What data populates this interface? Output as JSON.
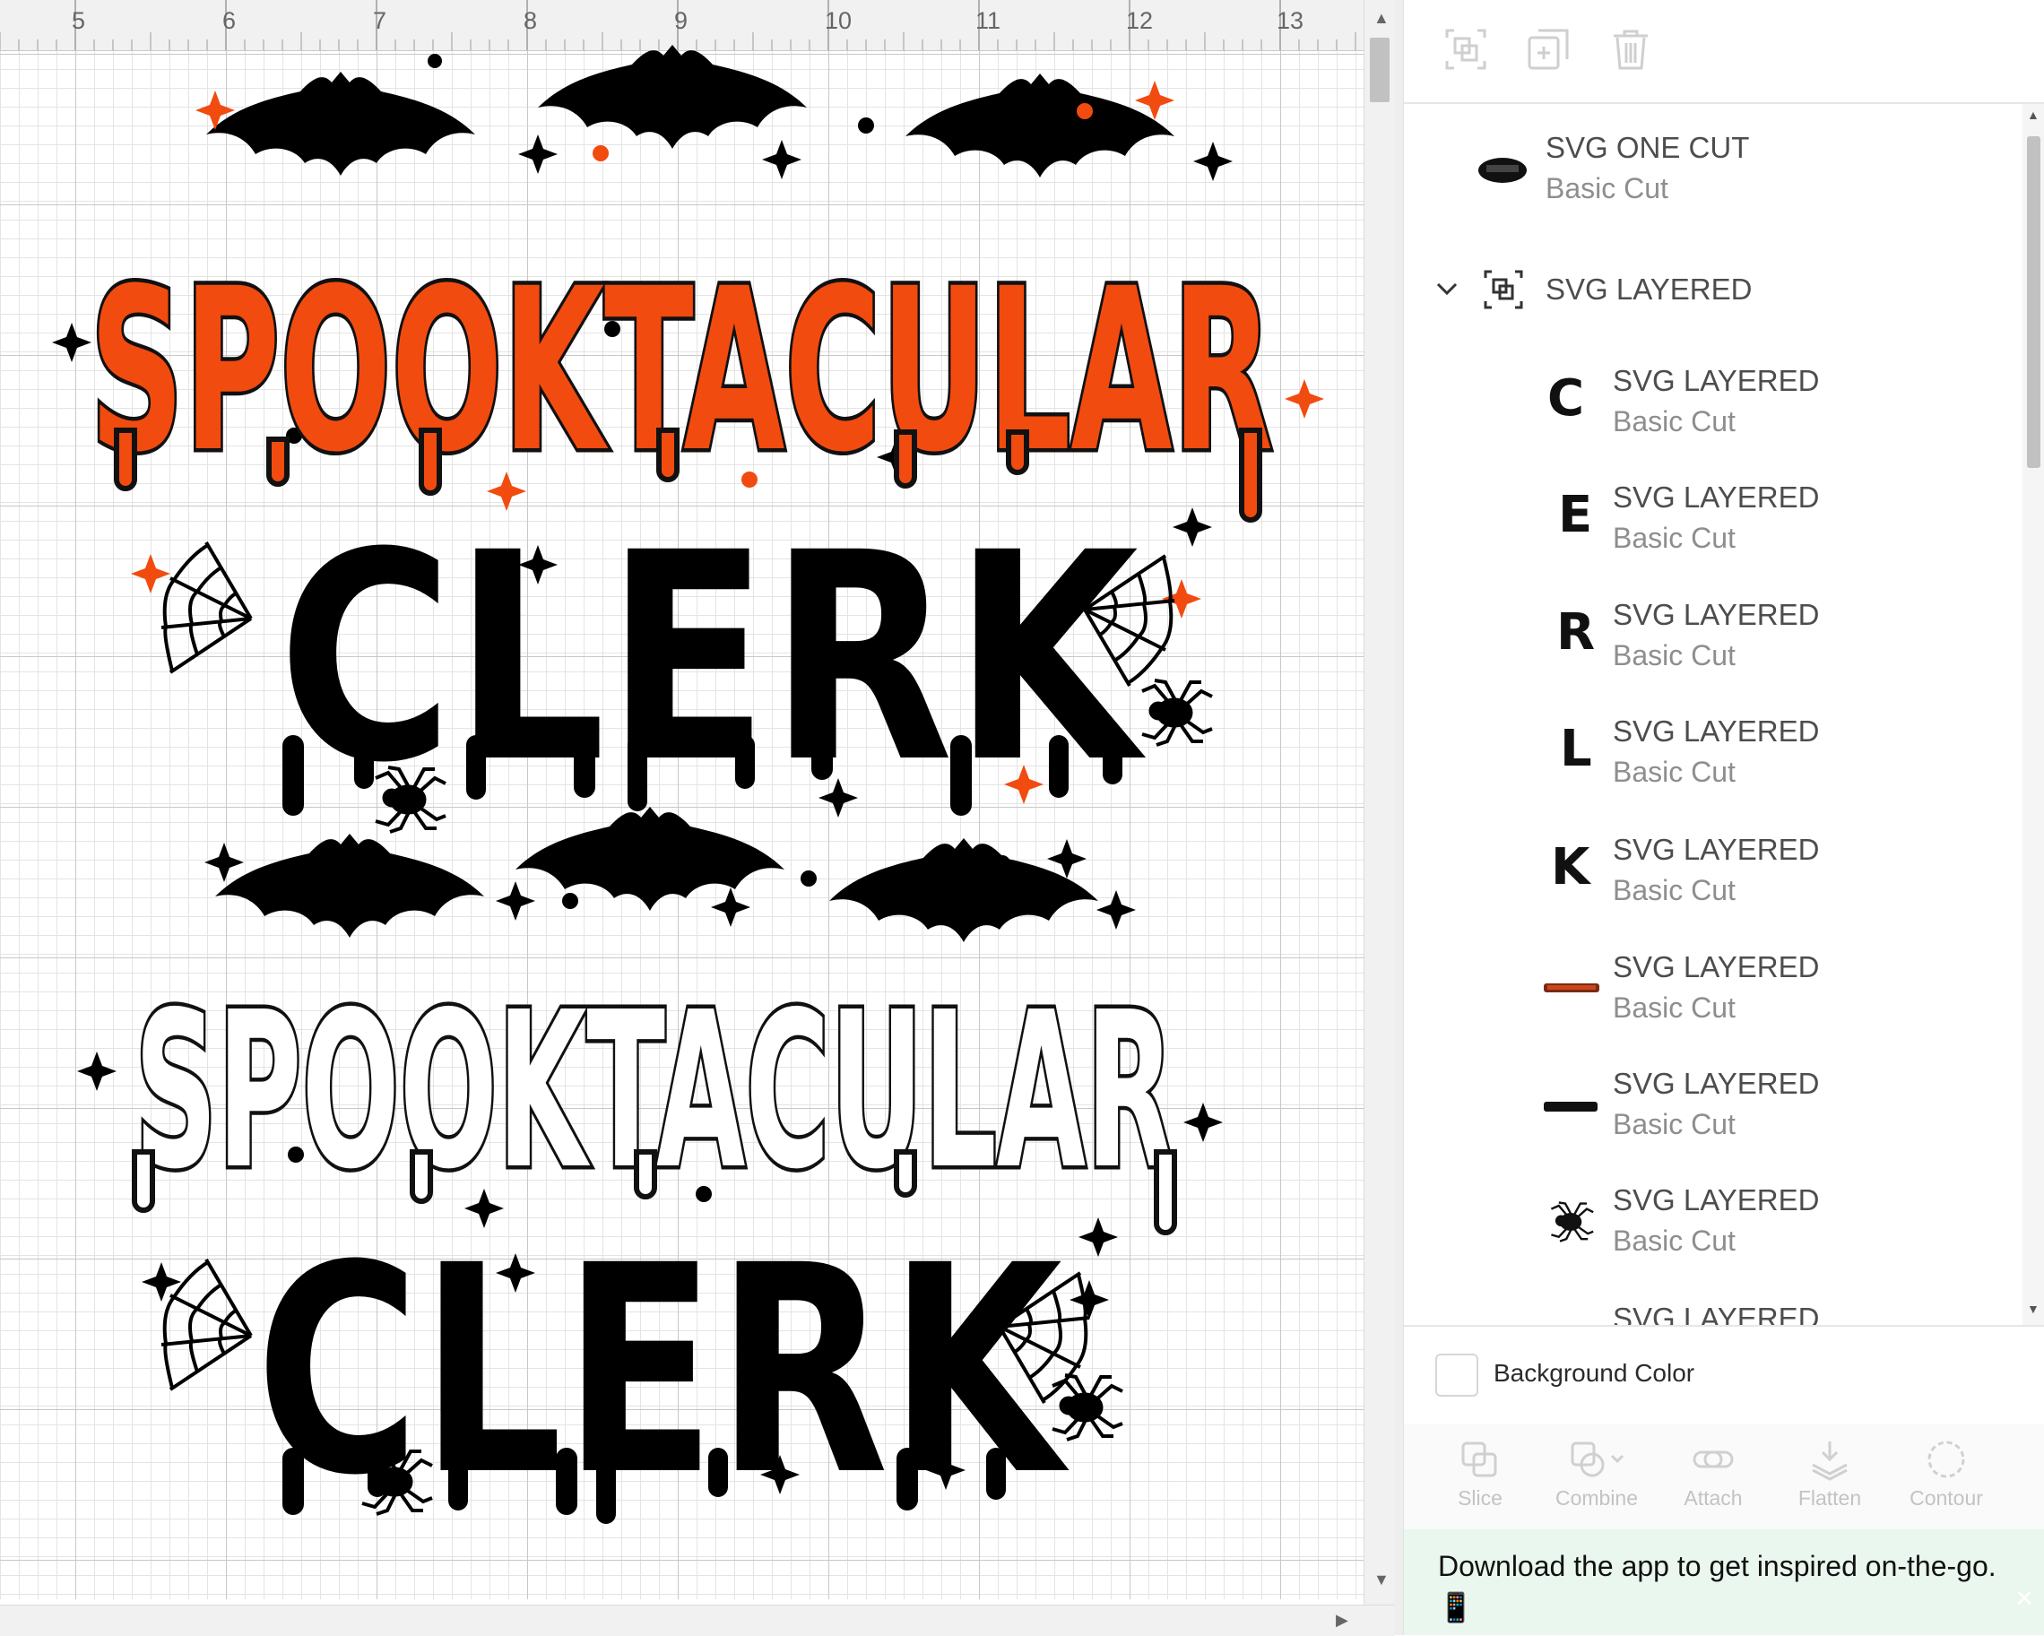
{
  "ruler": {
    "numbers": [
      "5",
      "6",
      "7",
      "8",
      "9",
      "10",
      "11",
      "12",
      "13"
    ]
  },
  "design": {
    "top": {
      "word1": "SPOOKTACULAR",
      "word2": "CLERK"
    },
    "bottom": {
      "word1": "SPOOKTACULAR",
      "word2": "CLERK"
    },
    "colors": {
      "orange": "#f24b0f",
      "black": "#000000",
      "outline": "#111111"
    }
  },
  "toolbar": {
    "icons": [
      "group-icon",
      "duplicate-icon",
      "delete-icon"
    ]
  },
  "layers": {
    "items": [
      {
        "name": "SVG ONE CUT",
        "sub": "Basic Cut",
        "thumb": "spooktacular-thumb"
      },
      {
        "name": "SVG LAYERED",
        "group": true
      },
      {
        "name": "SVG LAYERED",
        "sub": "Basic Cut",
        "thumb": "letter-c-thumb"
      },
      {
        "name": "SVG LAYERED",
        "sub": "Basic Cut",
        "thumb": "letter-e-thumb"
      },
      {
        "name": "SVG LAYERED",
        "sub": "Basic Cut",
        "thumb": "letter-r-thumb"
      },
      {
        "name": "SVG LAYERED",
        "sub": "Basic Cut",
        "thumb": "letter-l-thumb"
      },
      {
        "name": "SVG LAYERED",
        "sub": "Basic Cut",
        "thumb": "letter-k-thumb"
      },
      {
        "name": "SVG LAYERED",
        "sub": "Basic Cut",
        "thumb": "orange-word-thumb"
      },
      {
        "name": "SVG LAYERED",
        "sub": "Basic Cut",
        "thumb": "black-word-thumb"
      },
      {
        "name": "SVG LAYERED",
        "sub": "Basic Cut",
        "thumb": "spider-thumb"
      },
      {
        "name": "SVG LAYERED"
      }
    ]
  },
  "background": {
    "label": "Background Color"
  },
  "actions": {
    "slice": "Slice",
    "combine": "Combine",
    "attach": "Attach",
    "flatten": "Flatten",
    "contour": "Contour"
  },
  "banner": {
    "text": "Download the app to get inspired on-the-go. 📱"
  }
}
